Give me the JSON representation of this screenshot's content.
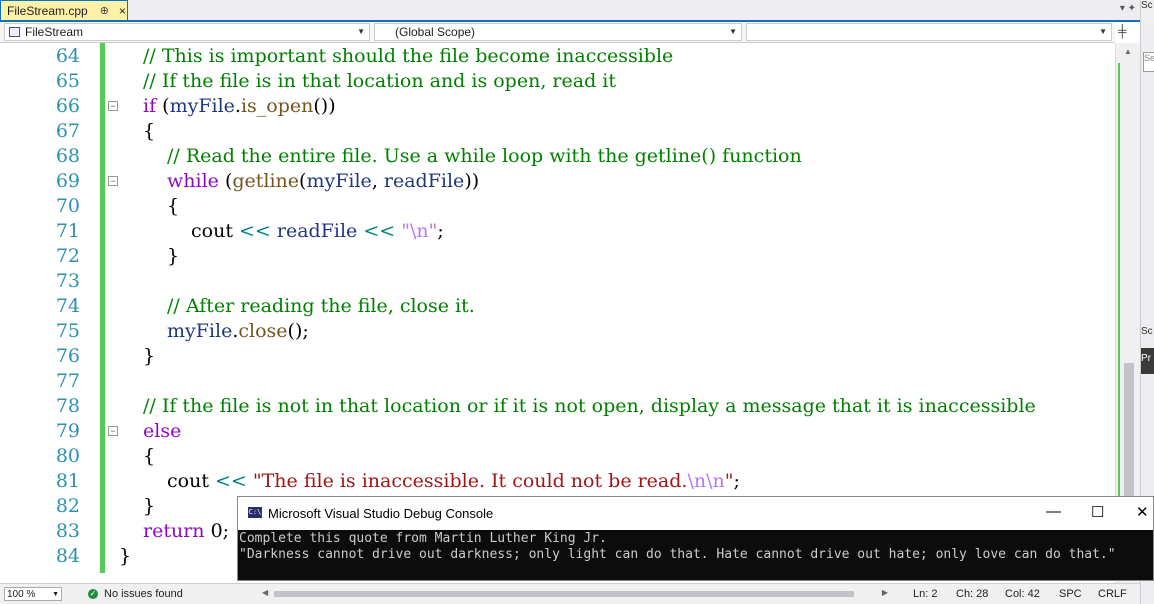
{
  "tab": {
    "filename": "FileStream.cpp",
    "pin": "⊕",
    "close": "×"
  },
  "tabbar_right": "▾ ✦",
  "nav": {
    "project": "FileStream",
    "scope": "(Global Scope)",
    "member": ""
  },
  "right_panel": {
    "p1": "Sc",
    "p2": "Se",
    "p3": "Pr",
    "p4": "Sc"
  },
  "code_lines": [
    {
      "n": "64",
      "indent": 0,
      "tokens": [
        [
          "c-cm",
          "// This is important should the file become inaccessible"
        ]
      ]
    },
    {
      "n": "65",
      "indent": 0,
      "tokens": [
        [
          "c-cm",
          "// If the file is in that location and is open, read it"
        ]
      ]
    },
    {
      "n": "66",
      "indent": 0,
      "fold": true,
      "tokens": [
        [
          "c-kw",
          "if"
        ],
        [
          "",
          " ("
        ],
        [
          "c-id",
          "myFile"
        ],
        [
          "",
          "."
        ],
        [
          "c-fn",
          "is_open"
        ],
        [
          "",
          "())"
        ]
      ]
    },
    {
      "n": "67",
      "indent": 0,
      "tokens": [
        [
          "",
          "{"
        ]
      ]
    },
    {
      "n": "68",
      "indent": 1,
      "tokens": [
        [
          "c-cm",
          "// Read the entire file. Use a while loop with the getline() function"
        ]
      ]
    },
    {
      "n": "69",
      "indent": 1,
      "fold": true,
      "tokens": [
        [
          "c-kw",
          "while"
        ],
        [
          "",
          " ("
        ],
        [
          "c-fn",
          "getline"
        ],
        [
          "",
          "("
        ],
        [
          "c-id",
          "myFile"
        ],
        [
          "",
          ", "
        ],
        [
          "c-id",
          "readFile"
        ],
        [
          "",
          "))"
        ]
      ]
    },
    {
      "n": "70",
      "indent": 1,
      "tokens": [
        [
          "",
          "{"
        ]
      ]
    },
    {
      "n": "71",
      "indent": 2,
      "tokens": [
        [
          "",
          "cout "
        ],
        [
          "c-op",
          "<<"
        ],
        [
          "",
          " "
        ],
        [
          "c-id",
          "readFile"
        ],
        [
          "",
          " "
        ],
        [
          "c-op",
          "<<"
        ],
        [
          "",
          " "
        ],
        [
          "c-esc",
          "\"\\n\""
        ],
        [
          "",
          ";"
        ]
      ]
    },
    {
      "n": "72",
      "indent": 1,
      "tokens": [
        [
          "",
          "}"
        ]
      ]
    },
    {
      "n": "73",
      "indent": 0,
      "tokens": []
    },
    {
      "n": "74",
      "indent": 1,
      "tokens": [
        [
          "c-cm",
          "// After reading the file, close it."
        ]
      ]
    },
    {
      "n": "75",
      "indent": 1,
      "tokens": [
        [
          "c-id",
          "myFile"
        ],
        [
          "",
          "."
        ],
        [
          "c-fn",
          "close"
        ],
        [
          "",
          "();"
        ]
      ]
    },
    {
      "n": "76",
      "indent": 0,
      "tokens": [
        [
          "",
          "}"
        ]
      ]
    },
    {
      "n": "77",
      "indent": 0,
      "tokens": []
    },
    {
      "n": "78",
      "indent": 0,
      "tokens": [
        [
          "c-cm",
          "// If the file is not in that location or if it is not open, display a message that it is inaccessible"
        ]
      ]
    },
    {
      "n": "79",
      "indent": 0,
      "fold": true,
      "tokens": [
        [
          "c-kw",
          "else"
        ]
      ]
    },
    {
      "n": "80",
      "indent": 0,
      "tokens": [
        [
          "",
          "{"
        ]
      ]
    },
    {
      "n": "81",
      "indent": 1,
      "tokens": [
        [
          "",
          "cout "
        ],
        [
          "c-op",
          "<<"
        ],
        [
          "",
          " "
        ],
        [
          "c-str",
          "\"The file is inaccessible. It could not be read."
        ],
        [
          "c-esc",
          "\\n\\n"
        ],
        [
          "c-str",
          "\""
        ],
        [
          "",
          ";"
        ]
      ]
    },
    {
      "n": "82",
      "indent": 0,
      "tokens": [
        [
          "",
          "}"
        ]
      ]
    },
    {
      "n": "83",
      "indent": 0,
      "tokens": [
        [
          "c-kw",
          "return"
        ],
        [
          "",
          " 0;"
        ]
      ]
    },
    {
      "n": "84",
      "indent": -1,
      "tokens": [
        [
          "",
          "}"
        ]
      ]
    }
  ],
  "console": {
    "title": "Microsoft Visual Studio Debug Console",
    "icon_text": "C:\\",
    "min": "—",
    "max": "☐",
    "close": "✕",
    "lines": [
      "Complete this quote from Martin Luther King Jr.",
      "\"Darkness cannot drive out darkness; only light can do that. Hate cannot drive out hate; only love can do that.\""
    ]
  },
  "status": {
    "zoom": "100 %",
    "issues": "No issues found",
    "ln": "Ln: 2",
    "ch": "Ch: 28",
    "col": "Col: 42",
    "spc": "SPC",
    "eol": "CRLF"
  }
}
